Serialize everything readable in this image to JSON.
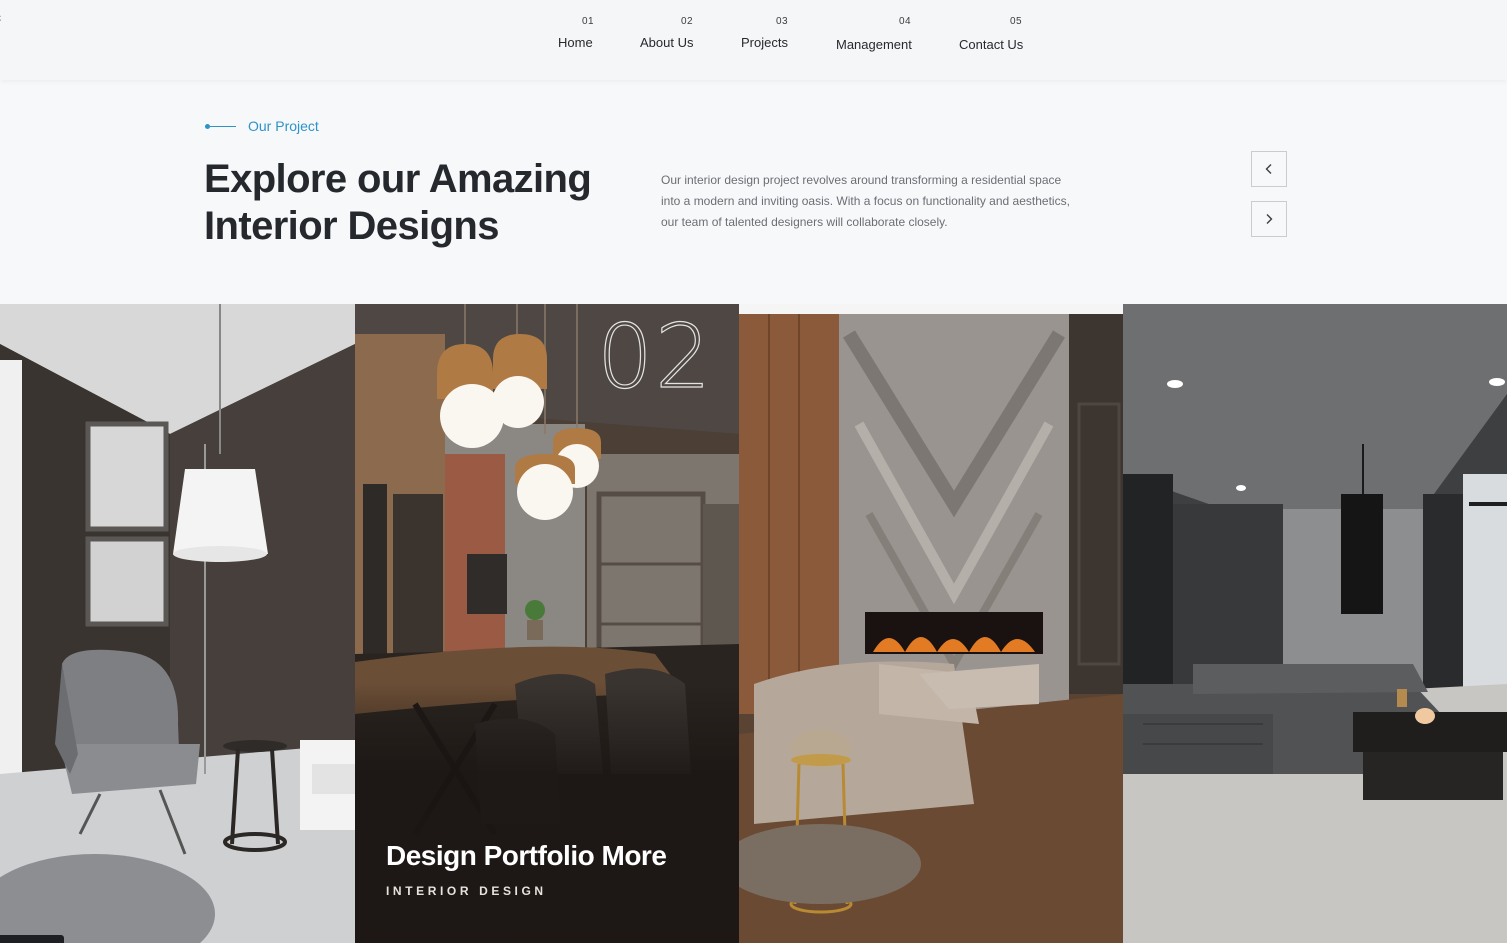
{
  "nav": [
    {
      "num": "01",
      "label": "Home"
    },
    {
      "num": "02",
      "label": "About Us"
    },
    {
      "num": "03",
      "label": "Projects"
    },
    {
      "num": "04",
      "label": "Management"
    },
    {
      "num": "05",
      "label": "Contact Us"
    }
  ],
  "section": {
    "eyebrow": "Our Project",
    "headline_line1": "Explore our Amazing",
    "headline_line2": "Interior Designs",
    "description_line1": "Our interior design project revolves around transforming a residential space",
    "description_line2": "into a modern and inviting oasis. With a focus on functionality and aesthetics,",
    "description_line3": "our team of talented designers will collaborate closely."
  },
  "slider": {
    "prev_icon": "chevron-left-icon",
    "next_icon": "chevron-right-icon"
  },
  "gallery": {
    "active_number": "02",
    "active_title": "Design Portfolio More",
    "active_subtitle": "INTERIOR DESIGN"
  },
  "colors": {
    "accent": "#2d93c9",
    "heading": "#25282d",
    "body_text": "#6b6e73",
    "background": "#f7f8fa"
  }
}
